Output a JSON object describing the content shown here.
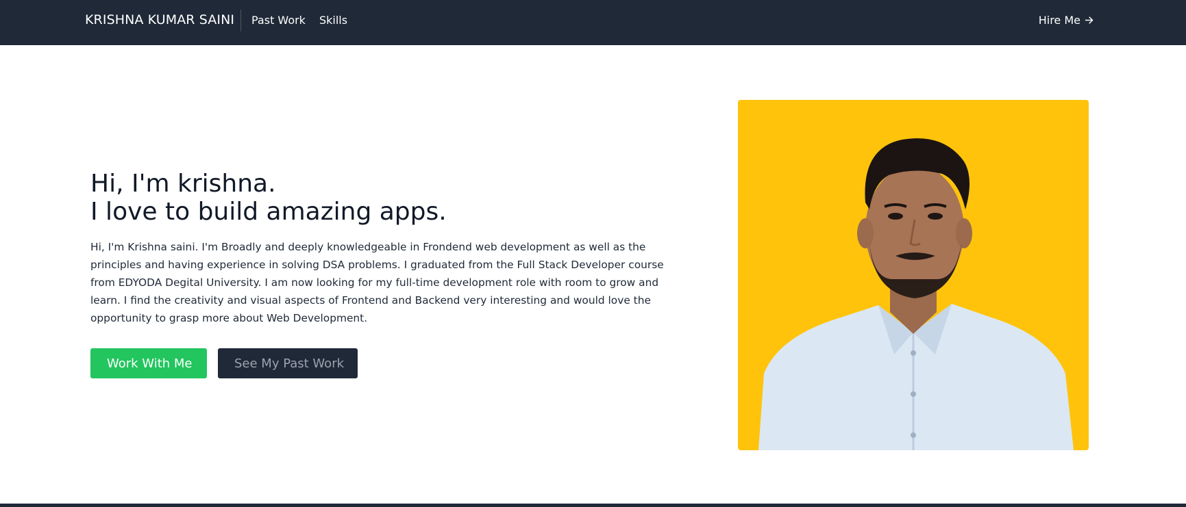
{
  "navbar": {
    "brand": "KRISHNA KUMAR SAINI",
    "links": [
      {
        "label": "Past Work"
      },
      {
        "label": "Skills"
      }
    ],
    "hire": {
      "label": "Hire Me",
      "icon": "arrow-right-icon"
    }
  },
  "hero": {
    "headline_line1": "Hi, I'm krishna.",
    "headline_line2": "I love to build amazing apps.",
    "intro": "Hi, I'm Krishna saini. I'm Broadly and deeply knowledgeable in Frondend web development as well as the principles and having experience in solving DSA problems. I graduated from the Full Stack Developer course from EDYODA Degital University. I am now looking for my full-time development role with room to grow and learn. I find the creativity and visual aspects of Frontend and Backend very interesting and would love the opportunity to grasp more about Web Development.",
    "primary_button": "Work With Me",
    "secondary_button": "See My Past Work"
  },
  "portrait": {
    "background_color": "#ffc30b",
    "icon": "profile-photo"
  },
  "colors": {
    "nav_bg": "#1f2937",
    "primary": "#22c55e",
    "secondary_bg": "#1f2937",
    "secondary_text": "#9ca3af"
  }
}
